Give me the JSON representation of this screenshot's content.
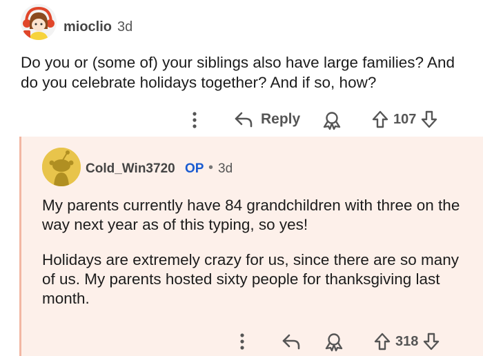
{
  "comment": {
    "username": "mioclio",
    "time": "3d",
    "body": "Do you or (some of) your siblings also have large families? And do you celebrate holidays together? And if so, how?",
    "actions": {
      "more_icon": "more-vertical-icon",
      "reply_label": "Reply",
      "award_icon": "award-icon",
      "vote_count": "107"
    }
  },
  "reply": {
    "username": "Cold_Win3720",
    "op_tag": "OP",
    "separator": "•",
    "time": "3d",
    "paragraphs": [
      "My parents currently have 84 grandchildren with three on the way next year as of this typing, so yes!",
      "Holidays are extremely crazy for us, since there are so many of us. My parents hosted sixty people for thanksgiving last month."
    ],
    "actions": {
      "more_icon": "more-vertical-icon",
      "reply_icon": "reply-arrow-icon",
      "award_icon": "award-icon",
      "vote_count": "318"
    },
    "colors": {
      "background": "#fdf0ea",
      "thread_line": "#f2b7a3",
      "op_tag": "#1a5bd1"
    }
  }
}
